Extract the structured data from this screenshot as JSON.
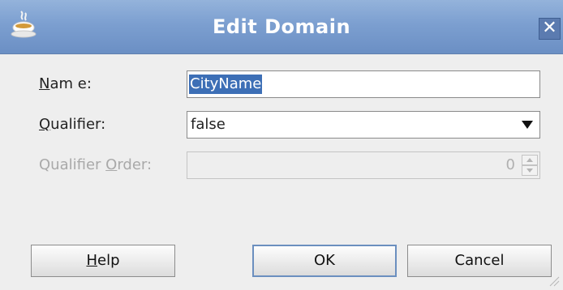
{
  "window": {
    "title": "Edit Domain",
    "close_symbol": "✕",
    "app_icon": "java-cup-icon"
  },
  "form": {
    "name_label": {
      "mnemonic": "N",
      "rest": "am e:"
    },
    "name_value": "CityName",
    "qualifier_label": {
      "mnemonic": "Q",
      "rest": "ualifier:"
    },
    "qualifier_value": "false",
    "qualifier_order_label": {
      "before": "Qualifier ",
      "mnemonic": "O",
      "rest": "rder:"
    },
    "qualifier_order_value": "0"
  },
  "buttons": {
    "help": {
      "mnemonic": "H",
      "rest": "elp"
    },
    "ok": "OK",
    "cancel": "Cancel"
  },
  "colors": {
    "title_bar": "#7c9fd0",
    "selection": "#3d6fb6",
    "dialog_bg": "#eeeeee"
  }
}
